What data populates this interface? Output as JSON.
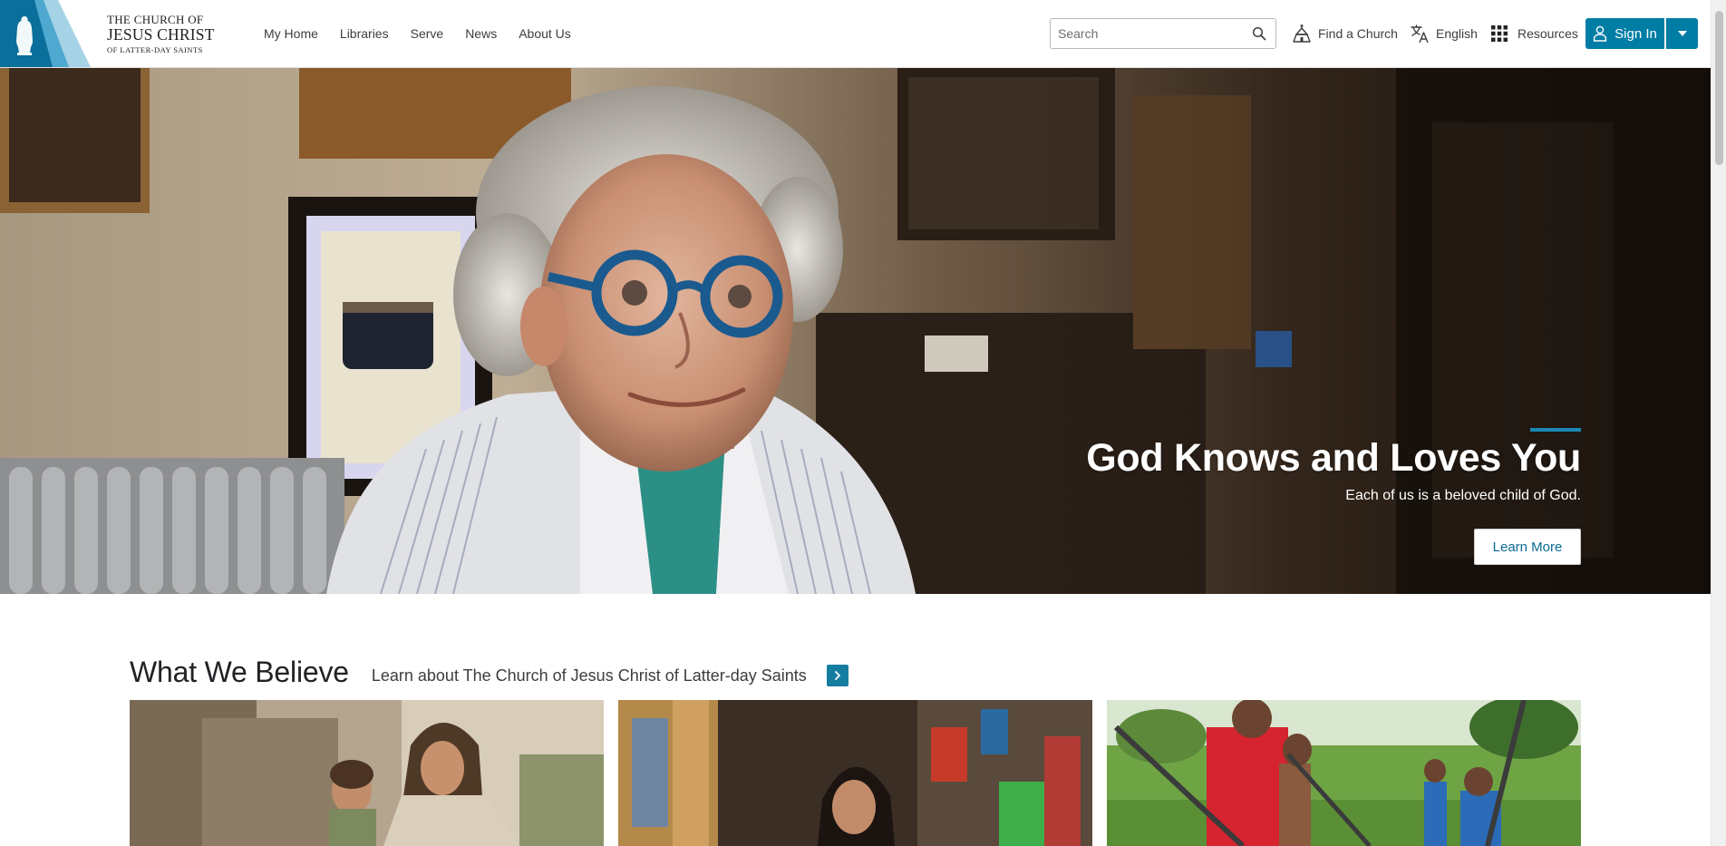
{
  "header": {
    "logo": {
      "line1": "THE CHURCH OF",
      "line2": "JESUS CHRIST",
      "line3": "OF LATTER-DAY SAINTS"
    },
    "nav": [
      "My Home",
      "Libraries",
      "Serve",
      "News",
      "About Us"
    ],
    "search": {
      "placeholder": "Search",
      "value": ""
    },
    "find_church": "Find a Church",
    "language": "English",
    "resources": "Resources",
    "sign_in": "Sign In"
  },
  "hero": {
    "title": "God Knows and Loves You",
    "subtitle": "Each of us is a beloved child of God.",
    "button": "Learn More"
  },
  "section": {
    "title": "What We Believe",
    "subtitle": "Learn about The Church of Jesus Christ of Latter-day Saints"
  },
  "colors": {
    "brand": "#007da5",
    "accent": "#1a87b5",
    "text": "#212225"
  },
  "icons": [
    "search-icon",
    "church-icon",
    "translate-icon",
    "grid-icon",
    "user-icon",
    "caret-down-icon",
    "chevron-right-icon"
  ]
}
